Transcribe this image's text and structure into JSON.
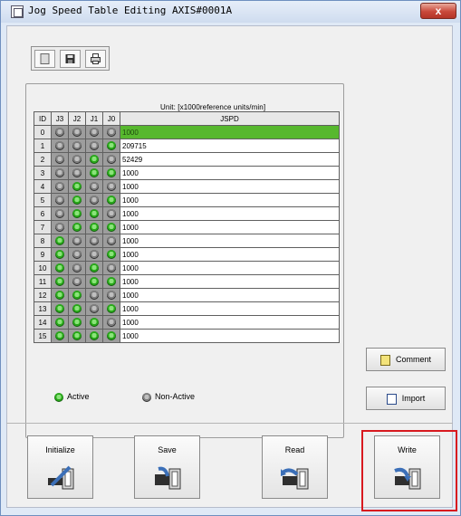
{
  "window": {
    "title": "Jog Speed Table Editing AXIS#0001A",
    "close_label": "x"
  },
  "toolbar": {
    "buttons": [
      "new-icon",
      "save-disk-icon",
      "print-icon"
    ]
  },
  "table": {
    "unit_label": "Unit: [x1000reference units/min]",
    "headers": {
      "id": "ID",
      "j3": "J3",
      "j2": "J2",
      "j1": "J1",
      "j0": "J0",
      "jspd": "JSPD"
    },
    "rows": [
      {
        "id": "0",
        "bits": [
          0,
          0,
          0,
          0
        ],
        "jspd": "1000",
        "selected": true
      },
      {
        "id": "1",
        "bits": [
          0,
          0,
          0,
          1
        ],
        "jspd": "209715"
      },
      {
        "id": "2",
        "bits": [
          0,
          0,
          1,
          0
        ],
        "jspd": "52429"
      },
      {
        "id": "3",
        "bits": [
          0,
          0,
          1,
          1
        ],
        "jspd": "1000"
      },
      {
        "id": "4",
        "bits": [
          0,
          1,
          0,
          0
        ],
        "jspd": "1000"
      },
      {
        "id": "5",
        "bits": [
          0,
          1,
          0,
          1
        ],
        "jspd": "1000"
      },
      {
        "id": "6",
        "bits": [
          0,
          1,
          1,
          0
        ],
        "jspd": "1000"
      },
      {
        "id": "7",
        "bits": [
          0,
          1,
          1,
          1
        ],
        "jspd": "1000"
      },
      {
        "id": "8",
        "bits": [
          1,
          0,
          0,
          0
        ],
        "jspd": "1000"
      },
      {
        "id": "9",
        "bits": [
          1,
          0,
          0,
          1
        ],
        "jspd": "1000"
      },
      {
        "id": "10",
        "bits": [
          1,
          0,
          1,
          0
        ],
        "jspd": "1000"
      },
      {
        "id": "11",
        "bits": [
          1,
          0,
          1,
          1
        ],
        "jspd": "1000"
      },
      {
        "id": "12",
        "bits": [
          1,
          1,
          0,
          0
        ],
        "jspd": "1000"
      },
      {
        "id": "13",
        "bits": [
          1,
          1,
          0,
          1
        ],
        "jspd": "1000"
      },
      {
        "id": "14",
        "bits": [
          1,
          1,
          1,
          0
        ],
        "jspd": "1000"
      },
      {
        "id": "15",
        "bits": [
          1,
          1,
          1,
          1
        ],
        "jspd": "1000"
      }
    ]
  },
  "legend": {
    "active": "Active",
    "non_active": "Non-Active"
  },
  "side_buttons": {
    "comment": "Comment",
    "import": "Import"
  },
  "actions": {
    "initialize": "Initialize",
    "save": "Save",
    "read": "Read",
    "write": "Write"
  },
  "colors": {
    "active_green": "#29a81a",
    "selected_row": "#57b82e",
    "highlight": "#d8191f"
  }
}
